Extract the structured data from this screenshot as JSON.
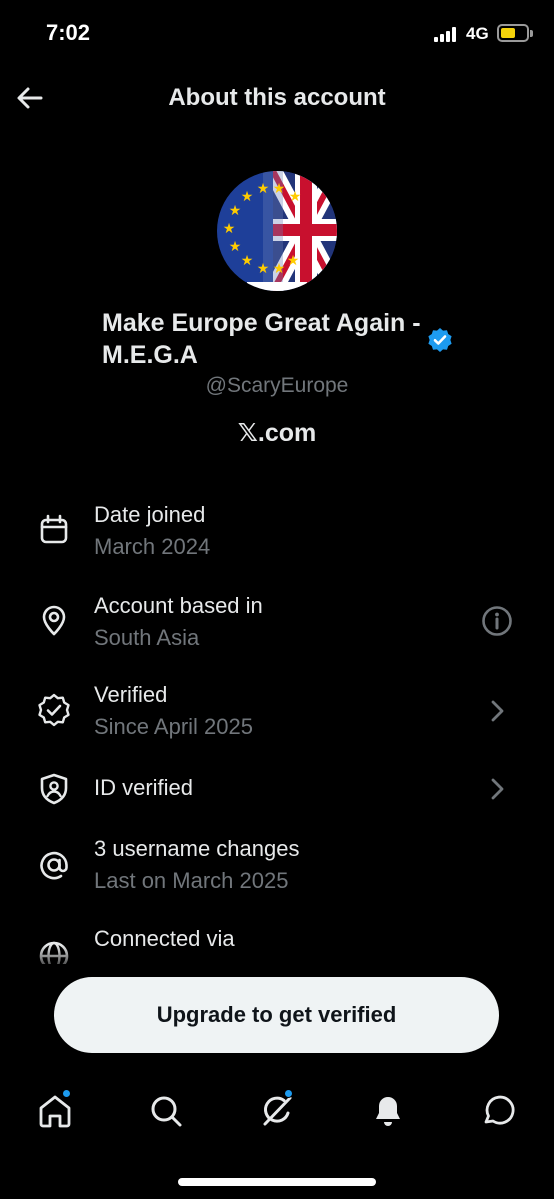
{
  "status_bar": {
    "time": "7:02",
    "network": "4G",
    "battery_color": "#f5d30b"
  },
  "header": {
    "title": "About this account",
    "back_icon": "arrow-left-icon"
  },
  "profile": {
    "display_name": "Make Europe Great Again - M.E.G.A",
    "handle": "@ScaryEurope",
    "site_prefix": "𝕏",
    "site_suffix": ".com",
    "verified_color": "#1d9bf0"
  },
  "info_rows": [
    {
      "icon": "calendar-icon",
      "title": "Date joined",
      "subtitle": "March 2024"
    },
    {
      "icon": "location-pin-icon",
      "title": "Account based in",
      "subtitle": "South Asia",
      "action_icon": "info-icon"
    },
    {
      "icon": "verified-check-icon",
      "title": "Verified",
      "subtitle": "Since April 2025",
      "action_icon": "chevron-right-icon"
    },
    {
      "icon": "id-shield-icon",
      "title": "ID verified",
      "action_icon": "chevron-right-icon"
    },
    {
      "icon": "at-sign-icon",
      "title": "3 username changes",
      "subtitle": "Last on March 2025"
    },
    {
      "icon": "globe-icon",
      "title": "Connected via"
    }
  ],
  "upgrade_button": {
    "label": "Upgrade to get verified"
  },
  "tab_bar": {
    "tabs": [
      "home-icon",
      "search-icon",
      "grok-icon",
      "notifications-icon",
      "messages-icon"
    ],
    "accent": "#1d9bf0"
  }
}
